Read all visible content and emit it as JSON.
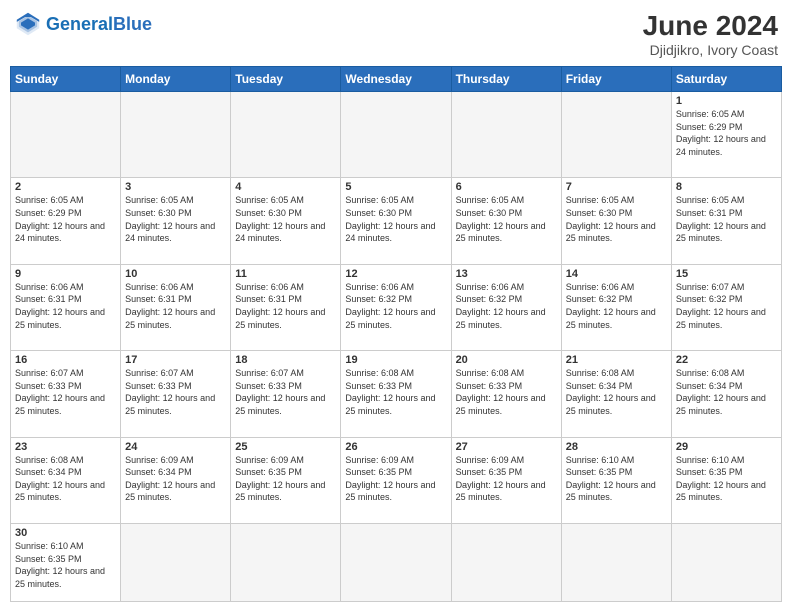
{
  "header": {
    "logo_general": "General",
    "logo_blue": "Blue",
    "title": "June 2024",
    "subtitle": "Djidjikro, Ivory Coast"
  },
  "days_of_week": [
    "Sunday",
    "Monday",
    "Tuesday",
    "Wednesday",
    "Thursday",
    "Friday",
    "Saturday"
  ],
  "weeks": [
    [
      {
        "day": "",
        "info": "",
        "empty": true
      },
      {
        "day": "",
        "info": "",
        "empty": true
      },
      {
        "day": "",
        "info": "",
        "empty": true
      },
      {
        "day": "",
        "info": "",
        "empty": true
      },
      {
        "day": "",
        "info": "",
        "empty": true
      },
      {
        "day": "",
        "info": "",
        "empty": true
      },
      {
        "day": "1",
        "info": "Sunrise: 6:05 AM\nSunset: 6:29 PM\nDaylight: 12 hours and 24 minutes.",
        "empty": false
      }
    ],
    [
      {
        "day": "2",
        "info": "Sunrise: 6:05 AM\nSunset: 6:29 PM\nDaylight: 12 hours and 24 minutes.",
        "empty": false
      },
      {
        "day": "3",
        "info": "Sunrise: 6:05 AM\nSunset: 6:30 PM\nDaylight: 12 hours and 24 minutes.",
        "empty": false
      },
      {
        "day": "4",
        "info": "Sunrise: 6:05 AM\nSunset: 6:30 PM\nDaylight: 12 hours and 24 minutes.",
        "empty": false
      },
      {
        "day": "5",
        "info": "Sunrise: 6:05 AM\nSunset: 6:30 PM\nDaylight: 12 hours and 24 minutes.",
        "empty": false
      },
      {
        "day": "6",
        "info": "Sunrise: 6:05 AM\nSunset: 6:30 PM\nDaylight: 12 hours and 25 minutes.",
        "empty": false
      },
      {
        "day": "7",
        "info": "Sunrise: 6:05 AM\nSunset: 6:30 PM\nDaylight: 12 hours and 25 minutes.",
        "empty": false
      },
      {
        "day": "8",
        "info": "Sunrise: 6:05 AM\nSunset: 6:31 PM\nDaylight: 12 hours and 25 minutes.",
        "empty": false
      }
    ],
    [
      {
        "day": "9",
        "info": "Sunrise: 6:06 AM\nSunset: 6:31 PM\nDaylight: 12 hours and 25 minutes.",
        "empty": false
      },
      {
        "day": "10",
        "info": "Sunrise: 6:06 AM\nSunset: 6:31 PM\nDaylight: 12 hours and 25 minutes.",
        "empty": false
      },
      {
        "day": "11",
        "info": "Sunrise: 6:06 AM\nSunset: 6:31 PM\nDaylight: 12 hours and 25 minutes.",
        "empty": false
      },
      {
        "day": "12",
        "info": "Sunrise: 6:06 AM\nSunset: 6:32 PM\nDaylight: 12 hours and 25 minutes.",
        "empty": false
      },
      {
        "day": "13",
        "info": "Sunrise: 6:06 AM\nSunset: 6:32 PM\nDaylight: 12 hours and 25 minutes.",
        "empty": false
      },
      {
        "day": "14",
        "info": "Sunrise: 6:06 AM\nSunset: 6:32 PM\nDaylight: 12 hours and 25 minutes.",
        "empty": false
      },
      {
        "day": "15",
        "info": "Sunrise: 6:07 AM\nSunset: 6:32 PM\nDaylight: 12 hours and 25 minutes.",
        "empty": false
      }
    ],
    [
      {
        "day": "16",
        "info": "Sunrise: 6:07 AM\nSunset: 6:33 PM\nDaylight: 12 hours and 25 minutes.",
        "empty": false
      },
      {
        "day": "17",
        "info": "Sunrise: 6:07 AM\nSunset: 6:33 PM\nDaylight: 12 hours and 25 minutes.",
        "empty": false
      },
      {
        "day": "18",
        "info": "Sunrise: 6:07 AM\nSunset: 6:33 PM\nDaylight: 12 hours and 25 minutes.",
        "empty": false
      },
      {
        "day": "19",
        "info": "Sunrise: 6:08 AM\nSunset: 6:33 PM\nDaylight: 12 hours and 25 minutes.",
        "empty": false
      },
      {
        "day": "20",
        "info": "Sunrise: 6:08 AM\nSunset: 6:33 PM\nDaylight: 12 hours and 25 minutes.",
        "empty": false
      },
      {
        "day": "21",
        "info": "Sunrise: 6:08 AM\nSunset: 6:34 PM\nDaylight: 12 hours and 25 minutes.",
        "empty": false
      },
      {
        "day": "22",
        "info": "Sunrise: 6:08 AM\nSunset: 6:34 PM\nDaylight: 12 hours and 25 minutes.",
        "empty": false
      }
    ],
    [
      {
        "day": "23",
        "info": "Sunrise: 6:08 AM\nSunset: 6:34 PM\nDaylight: 12 hours and 25 minutes.",
        "empty": false
      },
      {
        "day": "24",
        "info": "Sunrise: 6:09 AM\nSunset: 6:34 PM\nDaylight: 12 hours and 25 minutes.",
        "empty": false
      },
      {
        "day": "25",
        "info": "Sunrise: 6:09 AM\nSunset: 6:35 PM\nDaylight: 12 hours and 25 minutes.",
        "empty": false
      },
      {
        "day": "26",
        "info": "Sunrise: 6:09 AM\nSunset: 6:35 PM\nDaylight: 12 hours and 25 minutes.",
        "empty": false
      },
      {
        "day": "27",
        "info": "Sunrise: 6:09 AM\nSunset: 6:35 PM\nDaylight: 12 hours and 25 minutes.",
        "empty": false
      },
      {
        "day": "28",
        "info": "Sunrise: 6:10 AM\nSunset: 6:35 PM\nDaylight: 12 hours and 25 minutes.",
        "empty": false
      },
      {
        "day": "29",
        "info": "Sunrise: 6:10 AM\nSunset: 6:35 PM\nDaylight: 12 hours and 25 minutes.",
        "empty": false
      }
    ],
    [
      {
        "day": "30",
        "info": "Sunrise: 6:10 AM\nSunset: 6:35 PM\nDaylight: 12 hours and 25 minutes.",
        "empty": false,
        "last": true
      },
      {
        "day": "",
        "info": "",
        "empty": true,
        "last": true
      },
      {
        "day": "",
        "info": "",
        "empty": true,
        "last": true
      },
      {
        "day": "",
        "info": "",
        "empty": true,
        "last": true
      },
      {
        "day": "",
        "info": "",
        "empty": true,
        "last": true
      },
      {
        "day": "",
        "info": "",
        "empty": true,
        "last": true
      },
      {
        "day": "",
        "info": "",
        "empty": true,
        "last": true
      }
    ]
  ]
}
